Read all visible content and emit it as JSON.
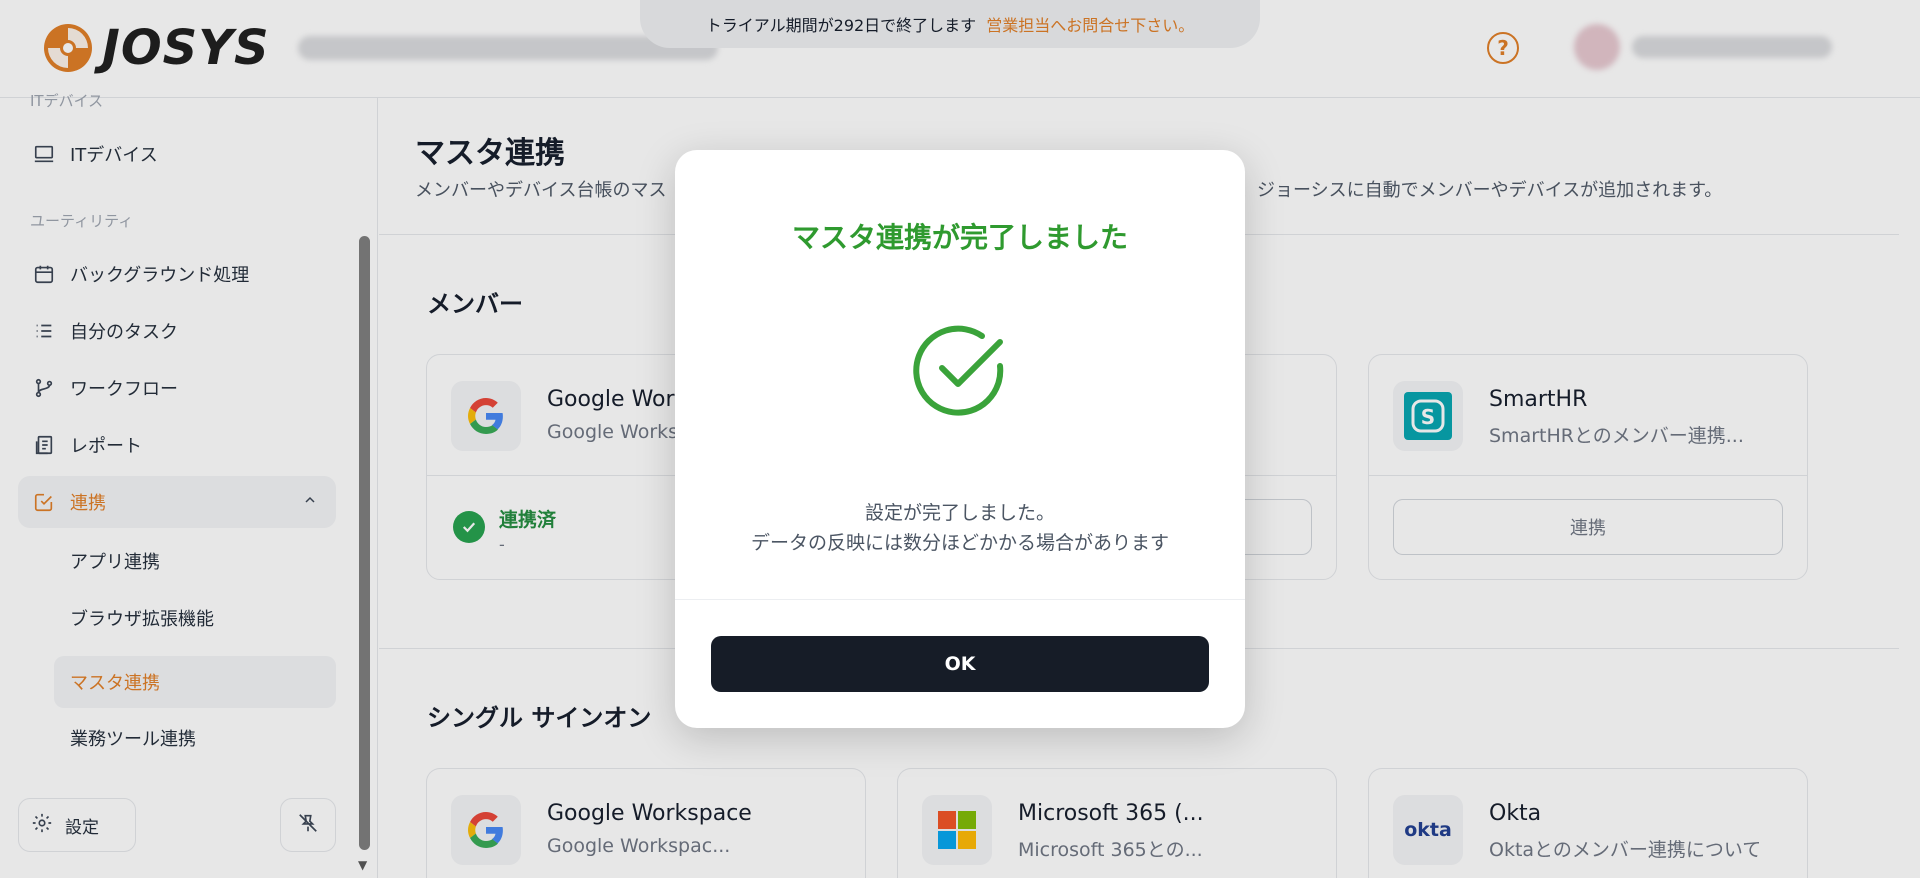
{
  "header": {
    "logo_text": "JOSYS",
    "trial_text": "トライアル期間が292日で終了します",
    "trial_link": "営業担当へお問合せ下さい。",
    "help_label": "?"
  },
  "sidebar": {
    "top_partial_label": "ITデバイス",
    "it_device_label": "ITデバイス",
    "utility_section": "ユーティリティ",
    "items": [
      {
        "label": "バックグラウンド処理"
      },
      {
        "label": "自分のタスク"
      },
      {
        "label": "ワークフロー"
      },
      {
        "label": "レポート"
      },
      {
        "label": "連携"
      }
    ],
    "sub_items": [
      {
        "label": "アプリ連携"
      },
      {
        "label": "ブラウザ拡張機能"
      },
      {
        "label": "マスタ連携"
      },
      {
        "label": "業務ツール連携"
      }
    ],
    "settings_label": "設定"
  },
  "main": {
    "title": "マスタ連携",
    "desc_left": "メンバーやデバイス台帳のマス",
    "desc_right": "、ジョーシスに自動でメンバーやデバイスが追加されます。",
    "members_title": "メンバー",
    "sso_title": "シングル サインオン",
    "member_cards": [
      {
        "name": "Google Wor",
        "sub": "Google Works",
        "status": "連携済",
        "status_sub": "-"
      },
      {
        "name": "SmartHR",
        "sub": "SmartHRとのメンバー連携...",
        "button": "連携"
      }
    ],
    "sso_cards": [
      {
        "name": "Google Workspace",
        "sub": "Google Workspac..."
      },
      {
        "name": "Microsoft 365 (...",
        "sub": "Microsoft 365との..."
      },
      {
        "name": "Okta",
        "sub": "Oktaとのメンバー連携について",
        "logo": "okta"
      }
    ]
  },
  "modal": {
    "title": "マスタ連携が完了しました",
    "message_line1": "設定が完了しました。",
    "message_line2": "データの反映には数分ほどかかる場合があります",
    "ok_label": "OK"
  },
  "colors": {
    "accent": "#e07b22",
    "success": "#2f9a2f",
    "dark_button": "#161c27"
  }
}
